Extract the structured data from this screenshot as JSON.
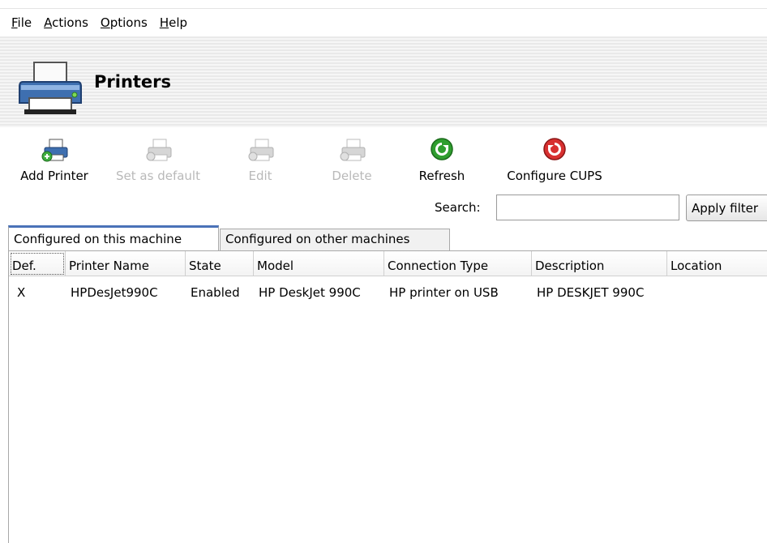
{
  "menu": {
    "items": [
      {
        "mnemonic": "F",
        "rest": "ile"
      },
      {
        "mnemonic": "A",
        "rest": "ctions"
      },
      {
        "mnemonic": "O",
        "rest": "ptions"
      },
      {
        "mnemonic": "H",
        "rest": "elp"
      }
    ]
  },
  "header": {
    "title": "Printers",
    "icon": "printer-icon"
  },
  "toolbar": {
    "add_printer": "Add Printer",
    "set_default": "Set as default",
    "edit": "Edit",
    "delete": "Delete",
    "refresh": "Refresh",
    "configure_cups": "Configure CUPS"
  },
  "search": {
    "label": "Search:",
    "value": "",
    "apply_label": "Apply filter"
  },
  "tabs": [
    "Configured on this machine",
    "Configured on other machines"
  ],
  "table": {
    "columns": [
      "Def.",
      "Printer Name",
      "State",
      "Model",
      "Connection Type",
      "Description",
      "Location"
    ],
    "rows": [
      [
        "X",
        "HPDesJet990C",
        "Enabled",
        "HP DeskJet 990C",
        "HP printer on USB",
        "HP DESKJET 990C",
        ""
      ]
    ]
  },
  "colors": {
    "refresh": "#2f9e2f",
    "configure": "#d83030",
    "tab_accent": "#4a72b8",
    "disabled_text": "#b9b9b9"
  }
}
